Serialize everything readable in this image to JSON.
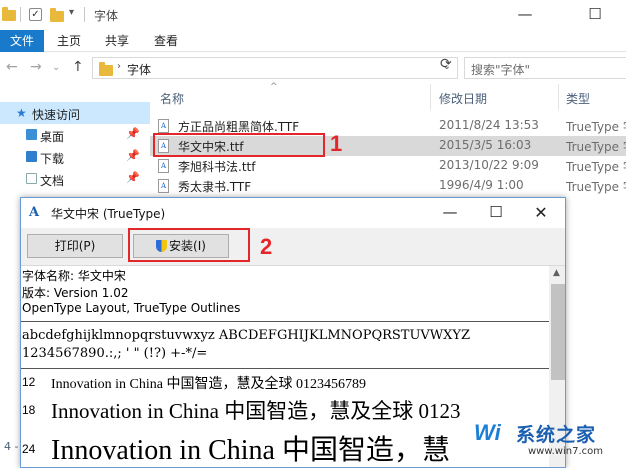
{
  "window": {
    "title": "字体"
  },
  "ribbon": {
    "tabs": [
      "文件",
      "主页",
      "共享",
      "查看"
    ]
  },
  "address": {
    "path": "字体",
    "search_placeholder": "搜索\"字体\""
  },
  "nav": {
    "quick_access": "快速访问",
    "items": [
      "桌面",
      "下载",
      "文档"
    ]
  },
  "columns": {
    "name": "名称",
    "date": "修改日期",
    "type": "类型"
  },
  "files": [
    {
      "name": "方正品尚粗黑简体.TTF",
      "date": "2011/8/24 13:53",
      "type": "TrueType 字"
    },
    {
      "name": "华文中宋.ttf",
      "date": "2015/3/5 16:03",
      "type": "TrueType 字"
    },
    {
      "name": "李旭科书法.ttf",
      "date": "2013/10/22 9:09",
      "type": "TrueType 字"
    },
    {
      "name": "秀太隶书.TTF",
      "date": "1996/4/9 1:00",
      "type": "TrueType 字"
    }
  ],
  "annotations": {
    "first": "1",
    "second": "2"
  },
  "dialog": {
    "title": "华文中宋 (TrueType)",
    "print_label": "打印(P)",
    "install_label": "安装(I)",
    "info": [
      "字体名称: 华文中宋",
      "版本: Version 1.02",
      "OpenType Layout, TrueType Outlines"
    ],
    "sample_lines": [
      "abcdefghijklmnopqrstuvwxyz ABCDEFGHIJKLMNOPQRSTUVWXYZ",
      "1234567890.:,; ' \" (!?) +-*/="
    ],
    "sizes": [
      {
        "size": "12",
        "text": "Innovation in China 中国智造，慧及全球 0123456789"
      },
      {
        "size": "18",
        "text": "Innovation in China 中国智造，慧及全球 0123"
      },
      {
        "size": "24",
        "text": "Innovation in China 中国智造，慧"
      }
    ]
  },
  "sidebar_stub": "4 -",
  "watermark": {
    "text": "系统之家",
    "url": "www.win7.com"
  }
}
